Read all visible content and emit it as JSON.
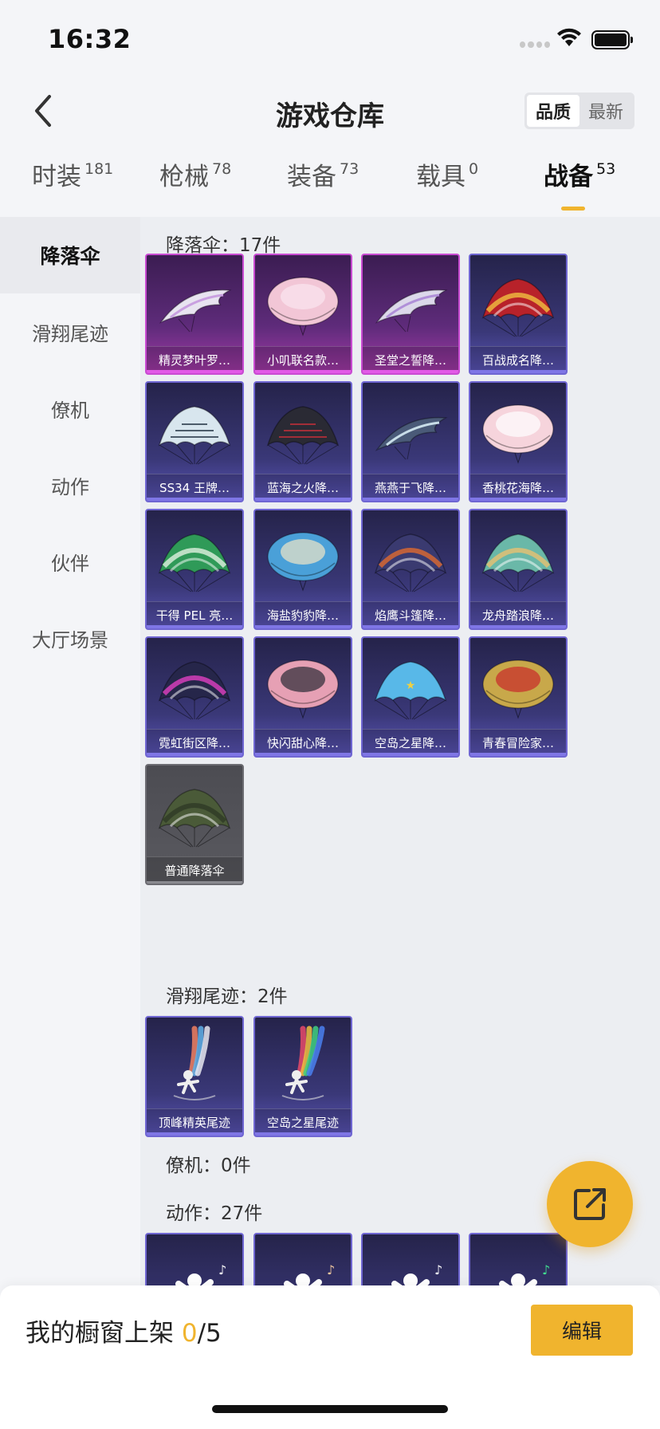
{
  "status_bar": {
    "time": "16:32"
  },
  "header": {
    "title": "游戏仓库",
    "sort_options": [
      {
        "label": "品质",
        "active": true
      },
      {
        "label": "最新",
        "active": false
      }
    ]
  },
  "tabs": [
    {
      "label": "时装",
      "count": "181",
      "active": false
    },
    {
      "label": "枪械",
      "count": "78",
      "active": false
    },
    {
      "label": "装备",
      "count": "73",
      "active": false
    },
    {
      "label": "载具",
      "count": "0",
      "active": false
    },
    {
      "label": "战备",
      "count": "53",
      "active": true
    }
  ],
  "sidebar": {
    "items": [
      {
        "label": "降落伞",
        "active": true
      },
      {
        "label": "滑翔尾迹",
        "active": false
      },
      {
        "label": "僚机",
        "active": false
      },
      {
        "label": "动作",
        "active": false
      },
      {
        "label": "伙伴",
        "active": false
      },
      {
        "label": "大厅场景",
        "active": false
      }
    ]
  },
  "sections": {
    "parachute": {
      "title": "降落伞：17件",
      "items": [
        {
          "name": "精灵梦叶罗…",
          "rarity": "epic",
          "icon": "parachute-fairy"
        },
        {
          "name": "小叽联名款…",
          "rarity": "epic",
          "icon": "parachute-pink-round"
        },
        {
          "name": "圣堂之誓降…",
          "rarity": "epic",
          "icon": "parachute-wing"
        },
        {
          "name": "百战成名降…",
          "rarity": "rare",
          "icon": "parachute-red-gold"
        },
        {
          "name": "SS34 王牌…",
          "rarity": "rare",
          "icon": "parachute-ss34"
        },
        {
          "name": "蓝海之火降…",
          "rarity": "rare",
          "icon": "parachute-dark-red"
        },
        {
          "name": "燕燕于飞降…",
          "rarity": "rare",
          "icon": "parachute-swallow"
        },
        {
          "name": "香桃花海降…",
          "rarity": "rare",
          "icon": "parachute-peach"
        },
        {
          "name": "干得 PEL 亮…",
          "rarity": "rare",
          "icon": "parachute-green"
        },
        {
          "name": "海盐豹豹降…",
          "rarity": "rare",
          "icon": "parachute-blue-striped"
        },
        {
          "name": "焰鹰斗篷降…",
          "rarity": "rare",
          "icon": "parachute-eagle"
        },
        {
          "name": "龙舟踏浪降…",
          "rarity": "rare",
          "icon": "parachute-dragonboat"
        },
        {
          "name": "霓虹街区降…",
          "rarity": "rare",
          "icon": "parachute-neon"
        },
        {
          "name": "快闪甜心降…",
          "rarity": "rare",
          "icon": "parachute-heart"
        },
        {
          "name": "空岛之星降…",
          "rarity": "rare",
          "icon": "parachute-sky-island"
        },
        {
          "name": "青春冒险家…",
          "rarity": "rare",
          "icon": "parachute-speed"
        },
        {
          "name": "普通降落伞",
          "rarity": "common",
          "icon": "parachute-olive"
        }
      ]
    },
    "trail": {
      "title": "滑翔尾迹：2件",
      "items": [
        {
          "name": "顶峰精英尾迹",
          "rarity": "rare",
          "icon": "trail-elite"
        },
        {
          "name": "空岛之星尾迹",
          "rarity": "rare",
          "icon": "trail-rainbow"
        }
      ]
    },
    "wingman": {
      "title": "僚机：0件"
    },
    "emote": {
      "title": "动作：27件",
      "items": [
        {
          "name": "",
          "rarity": "rare",
          "icon": "emote-music"
        },
        {
          "name": "",
          "rarity": "rare",
          "icon": "emote-bubble"
        },
        {
          "name": "",
          "rarity": "rare",
          "icon": "emote-dance"
        },
        {
          "name": "",
          "rarity": "rare",
          "icon": "emote-money"
        }
      ]
    }
  },
  "bottom_bar": {
    "showcase_label": "我的橱窗上架",
    "showcase_count": "0",
    "showcase_total": "/5",
    "edit_label": "编辑"
  },
  "colors": {
    "accent": "#f0b42e",
    "epic": "#c94bd2",
    "rare": "#6f66d2",
    "common": "#6c6c72"
  }
}
